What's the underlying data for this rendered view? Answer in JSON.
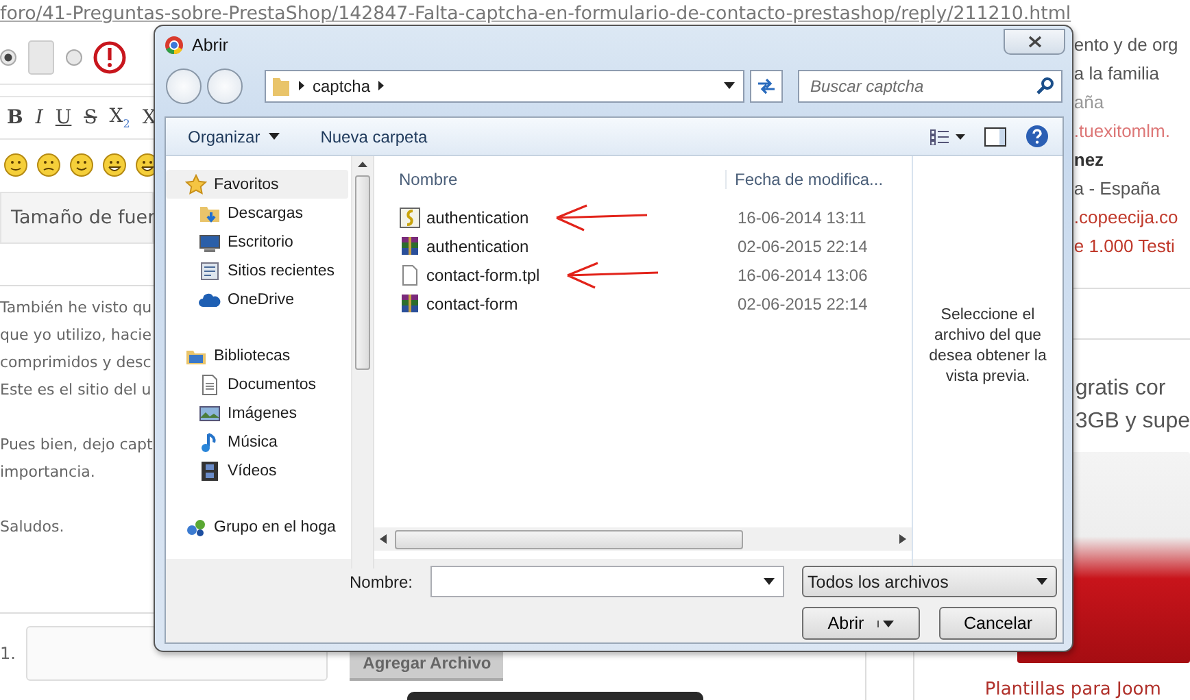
{
  "page": {
    "url": "foro/41-Preguntas-sobre-PrestaShop/142847-Falta-captcha-en-formulario-de-contacto-prestashop/reply/211210.html",
    "radios": [
      {
        "checked": true
      },
      {
        "checked": false
      }
    ],
    "format_buttons": [
      "B",
      "I",
      "U",
      "S",
      "X$_{2}$",
      "X"
    ],
    "font_size_select": "Tamaño de fuer",
    "paragraphs": [
      [
        "También he visto qu",
        "que yo utilizo, hacie",
        "comprimidos y desc",
        "Este es el sitio del u"
      ],
      [
        "Pues bien, dejo capt",
        "importancia."
      ],
      [
        "Saludos."
      ]
    ],
    "attachment_number": "1.",
    "add_file_button": "Agregar Archivo",
    "sidebar_lines": [
      {
        "text": "ento y de org",
        "kind": "plain"
      },
      {
        "text": "a la familia",
        "kind": "plain"
      },
      {
        "text": "aña",
        "kind": "faded"
      },
      {
        "text": ".tuexitomlm.",
        "kind": "faded-link"
      },
      {
        "text": "nez",
        "kind": "bold"
      },
      {
        "text": "a - España",
        "kind": "plain"
      },
      {
        "text": ".copeecija.co",
        "kind": "link"
      },
      {
        "text": "e 1.000 Testi",
        "kind": "link"
      }
    ],
    "promo_lines": [
      "gratis cor",
      "3GB y supe"
    ],
    "sidebar_link": "Plantillas para Joom"
  },
  "dialog": {
    "title": "Abrir",
    "breadcrumb": [
      "captcha"
    ],
    "search_placeholder": "Buscar captcha",
    "toolbar": [
      {
        "label": "Organizar",
        "dropdown": true
      },
      {
        "label": "Nueva carpeta",
        "dropdown": false
      }
    ],
    "nav": [
      {
        "label": "Favoritos",
        "selected": true,
        "children": [
          {
            "label": "Descargas",
            "selected": false
          },
          {
            "label": "Escritorio",
            "selected": false
          },
          {
            "label": "Sitios recientes",
            "selected": false
          },
          {
            "label": "OneDrive",
            "selected": false
          }
        ]
      },
      {
        "label": "Bibliotecas",
        "selected": false,
        "children": [
          {
            "label": "Documentos",
            "selected": false
          },
          {
            "label": "Imágenes",
            "selected": false
          },
          {
            "label": "Música",
            "selected": false
          },
          {
            "label": "Vídeos",
            "selected": false
          }
        ]
      },
      {
        "label": "Grupo en el hoga",
        "selected": false
      }
    ],
    "columns": [
      "Nombre",
      "Fecha de modifica..."
    ],
    "files": [
      {
        "name": "authentication",
        "kind": "script",
        "date": "16-06-2014 13:11",
        "marked": true
      },
      {
        "name": "authentication",
        "kind": "archive",
        "date": "02-06-2015 22:14",
        "marked": false
      },
      {
        "name": "contact-form.tpl",
        "kind": "file",
        "date": "16-06-2014 13:06",
        "marked": true
      },
      {
        "name": "contact-form",
        "kind": "archive",
        "date": "02-06-2015 22:14",
        "marked": false
      }
    ],
    "preview_hint": "Seleccione el archivo del que desea obtener la vista previa.",
    "filename_label": "Nombre:",
    "filter": "Todos los archivos",
    "open_button": "Abrir",
    "cancel_button": "Cancelar"
  }
}
